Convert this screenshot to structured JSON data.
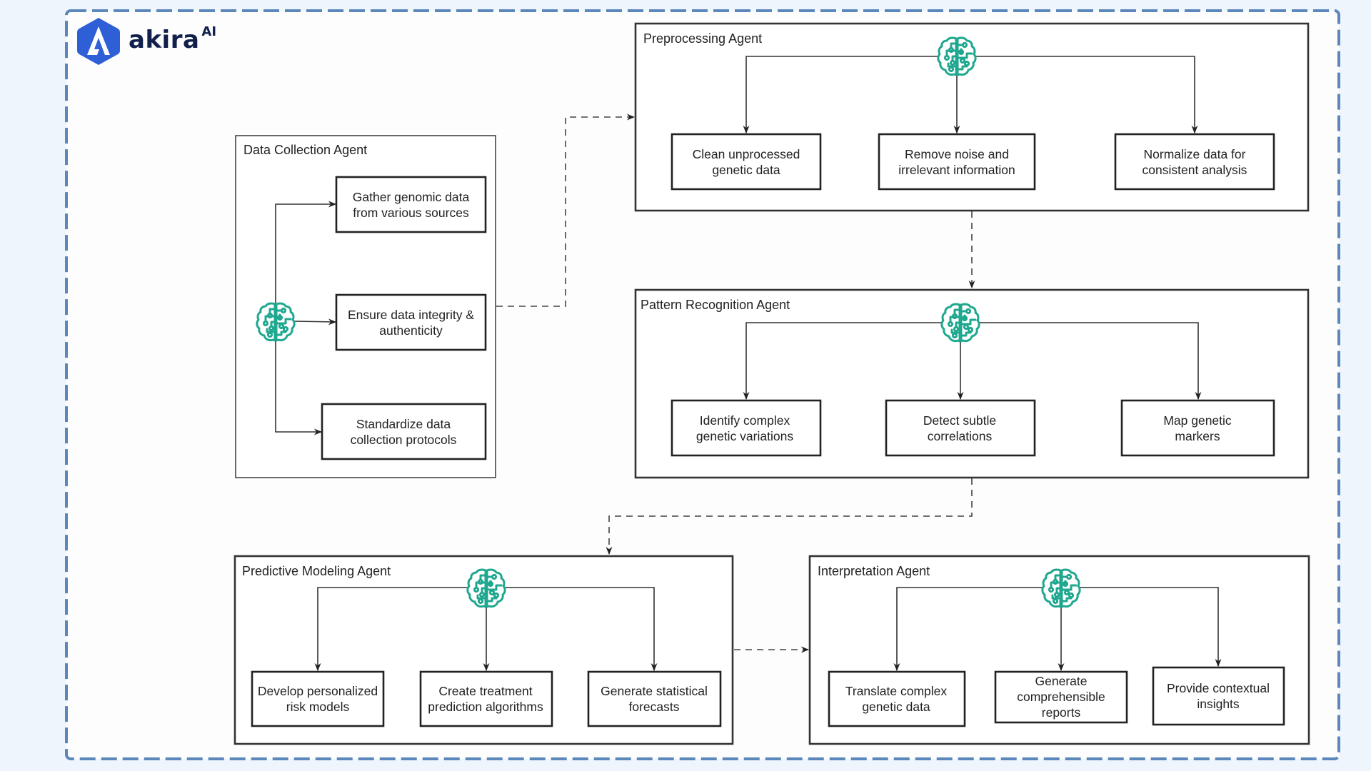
{
  "brand": {
    "name": "akira",
    "suffix": "AI",
    "color": "#2f5fd6"
  },
  "colors": {
    "frame_dash": "#5b87bb",
    "icon_teal": "#1fa88f",
    "line": "#222222"
  },
  "agents": {
    "data_collection": {
      "title": "Data Collection Agent",
      "icon": "brain-circuit-icon",
      "tasks": [
        {
          "lines": [
            "Gather genomic data",
            "from various sources"
          ]
        },
        {
          "lines": [
            "Ensure data integrity &",
            "authenticity"
          ]
        },
        {
          "lines": [
            "Standardize data",
            "collection protocols"
          ]
        }
      ]
    },
    "preprocessing": {
      "title": "Preprocessing Agent",
      "icon": "brain-circuit-icon",
      "tasks": [
        {
          "lines": [
            "Clean unprocessed",
            "genetic data"
          ]
        },
        {
          "lines": [
            "Remove noise and",
            "irrelevant information"
          ]
        },
        {
          "lines": [
            "Normalize data for",
            "consistent analysis"
          ]
        }
      ]
    },
    "pattern_recognition": {
      "title": "Pattern Recognition Agent",
      "icon": "brain-circuit-icon",
      "tasks": [
        {
          "lines": [
            "Identify complex",
            "genetic variations"
          ]
        },
        {
          "lines": [
            "Detect subtle",
            "correlations"
          ]
        },
        {
          "lines": [
            "Map genetic",
            "markers"
          ]
        }
      ]
    },
    "predictive_modeling": {
      "title": "Predictive Modeling Agent",
      "icon": "brain-circuit-icon",
      "tasks": [
        {
          "lines": [
            "Develop personalized",
            "risk models"
          ]
        },
        {
          "lines": [
            "Create treatment",
            "prediction algorithms"
          ]
        },
        {
          "lines": [
            "Generate statistical",
            "forecasts"
          ]
        }
      ]
    },
    "interpretation": {
      "title": "Interpretation Agent",
      "icon": "brain-circuit-icon",
      "tasks": [
        {
          "lines": [
            "Translate complex",
            "genetic data"
          ]
        },
        {
          "lines": [
            "Generate",
            "comprehensible",
            "reports"
          ]
        },
        {
          "lines": [
            "Provide contextual",
            "insights"
          ]
        }
      ]
    }
  },
  "flow": [
    {
      "from": "Data Collection Agent",
      "to": "Preprocessing Agent",
      "style": "dashed"
    },
    {
      "from": "Preprocessing Agent",
      "to": "Pattern Recognition Agent",
      "style": "dashed"
    },
    {
      "from": "Pattern Recognition Agent",
      "to": "Predictive Modeling Agent",
      "style": "dashed"
    },
    {
      "from": "Predictive Modeling Agent",
      "to": "Interpretation Agent",
      "style": "dashed"
    }
  ]
}
